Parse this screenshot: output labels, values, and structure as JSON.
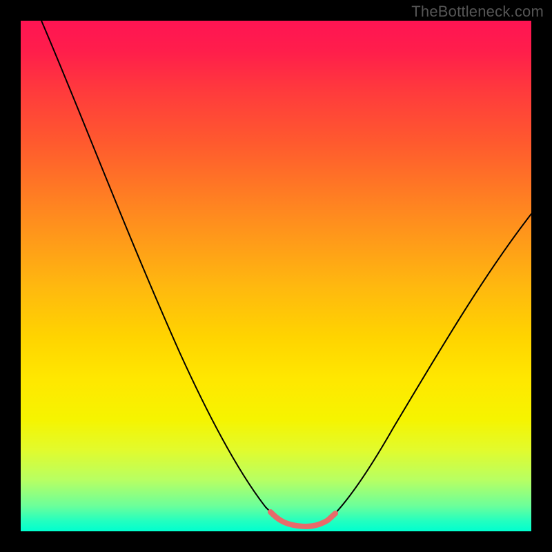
{
  "watermark": "TheBottleneck.com",
  "chart_data": {
    "type": "line",
    "title": "",
    "xlabel": "",
    "ylabel": "",
    "x_range": [
      0,
      100
    ],
    "y_range": [
      0,
      100
    ],
    "background_gradient": {
      "top_color": "#ff1453",
      "bottom_color": "#00ffcf",
      "semantic": "red-to-green (bad-to-good)"
    },
    "series": [
      {
        "name": "bottleneck-curve",
        "color": "#000000",
        "x": [
          0,
          5,
          10,
          15,
          20,
          25,
          30,
          35,
          40,
          45,
          48,
          52,
          55,
          58,
          60,
          65,
          70,
          75,
          80,
          85,
          90,
          95,
          100
        ],
        "values": [
          100,
          90,
          80,
          70,
          60,
          50,
          40,
          30,
          20,
          10,
          5,
          1,
          0,
          0,
          1,
          5,
          12,
          20,
          30,
          40,
          50,
          58,
          62
        ]
      }
    ],
    "highlight_region": {
      "name": "optimal-range",
      "color": "#e86a6a",
      "x_start": 48,
      "x_end": 60,
      "y_approx": 0
    },
    "description": "V-shaped curve descending steeply from top-left, reaching a flat minimum around x≈52–58, then rising to the upper-right. The flat bottom is highlighted in red."
  }
}
